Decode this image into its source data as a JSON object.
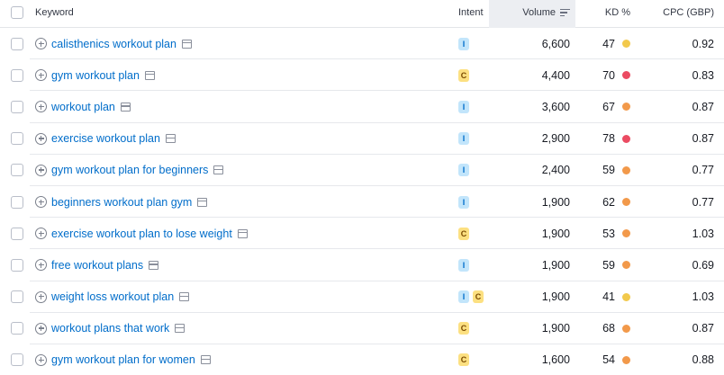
{
  "header": {
    "keyword": "Keyword",
    "intent": "Intent",
    "volume": "Volume",
    "kd": "KD %",
    "cpc": "CPC (GBP)"
  },
  "colors": {
    "link": "#006dca",
    "kd_yellow": "#f2c94c",
    "kd_orange": "#f2994a",
    "kd_red": "#eb4b62"
  },
  "icons": {
    "add": "plus-circle-icon",
    "serp": "serp-features-icon",
    "sort": "sort-descending-icon"
  },
  "rows": [
    {
      "keyword": "calisthenics workout plan",
      "intents": [
        "I"
      ],
      "volume": "6,600",
      "kd": "47",
      "kd_color": "#f2c94c",
      "cpc": "0.92"
    },
    {
      "keyword": "gym workout plan",
      "intents": [
        "C"
      ],
      "volume": "4,400",
      "kd": "70",
      "kd_color": "#eb4b62",
      "cpc": "0.83"
    },
    {
      "keyword": "workout plan",
      "intents": [
        "I"
      ],
      "volume": "3,600",
      "kd": "67",
      "kd_color": "#f2994a",
      "cpc": "0.87"
    },
    {
      "keyword": "exercise workout plan",
      "intents": [
        "I"
      ],
      "volume": "2,900",
      "kd": "78",
      "kd_color": "#eb4b62",
      "cpc": "0.87"
    },
    {
      "keyword": "gym workout plan for beginners",
      "intents": [
        "I"
      ],
      "volume": "2,400",
      "kd": "59",
      "kd_color": "#f2994a",
      "cpc": "0.77"
    },
    {
      "keyword": "beginners workout plan gym",
      "intents": [
        "I"
      ],
      "volume": "1,900",
      "kd": "62",
      "kd_color": "#f2994a",
      "cpc": "0.77"
    },
    {
      "keyword": "exercise workout plan to lose weight",
      "intents": [
        "C"
      ],
      "volume": "1,900",
      "kd": "53",
      "kd_color": "#f2994a",
      "cpc": "1.03"
    },
    {
      "keyword": "free workout plans",
      "intents": [
        "I"
      ],
      "volume": "1,900",
      "kd": "59",
      "kd_color": "#f2994a",
      "cpc": "0.69"
    },
    {
      "keyword": "weight loss workout plan",
      "intents": [
        "I",
        "C"
      ],
      "volume": "1,900",
      "kd": "41",
      "kd_color": "#f2c94c",
      "cpc": "1.03"
    },
    {
      "keyword": "workout plans that work",
      "intents": [
        "C"
      ],
      "volume": "1,900",
      "kd": "68",
      "kd_color": "#f2994a",
      "cpc": "0.87"
    },
    {
      "keyword": "gym workout plan for women",
      "intents": [
        "C"
      ],
      "volume": "1,600",
      "kd": "54",
      "kd_color": "#f2994a",
      "cpc": "0.88"
    }
  ]
}
